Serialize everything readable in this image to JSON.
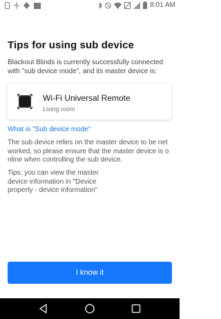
{
  "status_bar": {
    "time": "8:01 AM",
    "left_icons": [
      "smartphone-icon",
      "usb-icon",
      "notification-icon",
      "image-icon"
    ],
    "right_icons": [
      "bluetooth-icon",
      "mute-icon",
      "wifi-icon",
      "data-off-icon",
      "signal-icon",
      "battery-icon"
    ]
  },
  "page": {
    "title": "Tips for using sub device",
    "intro": "Blackout Blinds is currently successfully connected with \"sub device mode\", and its master device is:"
  },
  "device": {
    "name": "Wi-Fi Universal Remote",
    "room": "Living room",
    "icon": "remote-hub-icon"
  },
  "link": {
    "label": "What is \"Sub device mode\""
  },
  "paragraphs": {
    "reliance": "The sub device relies on the master device to be net worked, so please ensure that the master device is o nline when controlling the sub device.",
    "tips": "Tips: you can view the master device information in \"Device property - device information\""
  },
  "actions": {
    "confirm_label": "I know it"
  },
  "nav_bar": {
    "icons": [
      "back-icon",
      "home-icon",
      "recents-icon"
    ]
  },
  "colors": {
    "accent": "#1677ff",
    "link": "#1a73e8",
    "nav_background": "#000000"
  }
}
